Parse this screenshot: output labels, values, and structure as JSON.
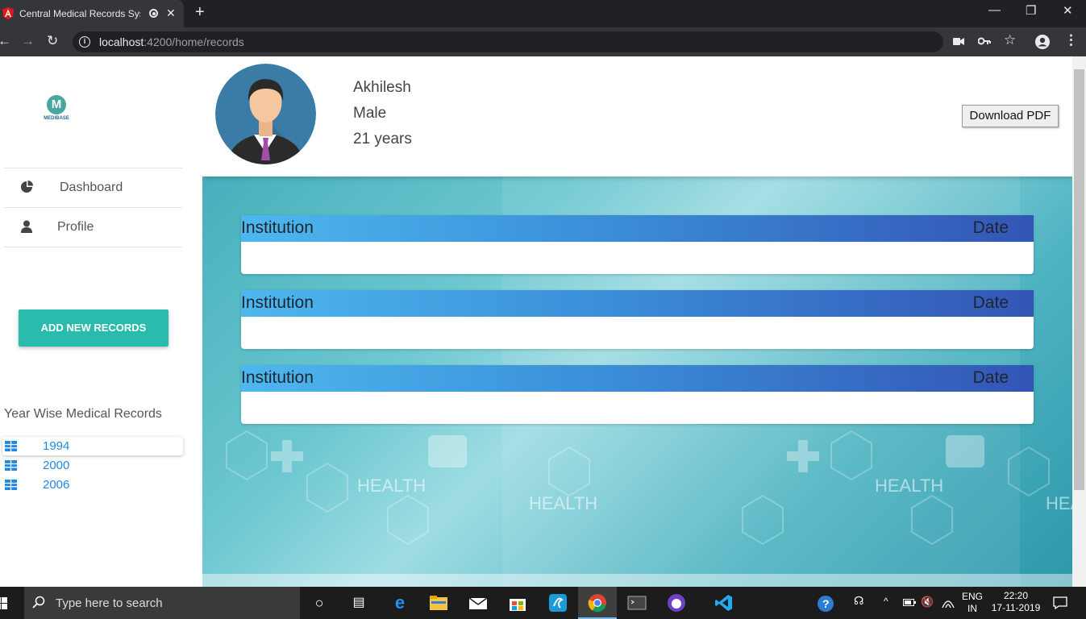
{
  "browser": {
    "tab_title": "Central Medical Records System",
    "url_host": "localhost",
    "url_rest": ":4200/home/records"
  },
  "sidebar": {
    "logo_letter": "M",
    "logo_text": "MEDIBASE",
    "nav": [
      {
        "label": "Dashboard",
        "icon": "pie-chart-icon"
      },
      {
        "label": "Profile",
        "icon": "person-icon"
      }
    ],
    "add_button": "ADD NEW RECORDS",
    "year_title": "Year Wise Medical Records",
    "years": [
      "1994",
      "2000",
      "2006"
    ]
  },
  "patient": {
    "name": "Akhilesh",
    "gender": "Male",
    "age": "21 years"
  },
  "download_label": "Download PDF",
  "records": [
    {
      "institution": "Institution",
      "date": "Date"
    },
    {
      "institution": "Institution",
      "date": "Date"
    },
    {
      "institution": "Institution",
      "date": "Date"
    }
  ],
  "taskbar": {
    "search_placeholder": "Type here to search",
    "lang_line1": "ENG",
    "lang_line2": "IN",
    "time": "22:20",
    "date": "17-11-2019"
  },
  "colors": {
    "accent": "#2bbbad",
    "card_gradient_start": "#4db7ee",
    "card_gradient_end": "#3355b5",
    "link": "#1e88e5"
  }
}
